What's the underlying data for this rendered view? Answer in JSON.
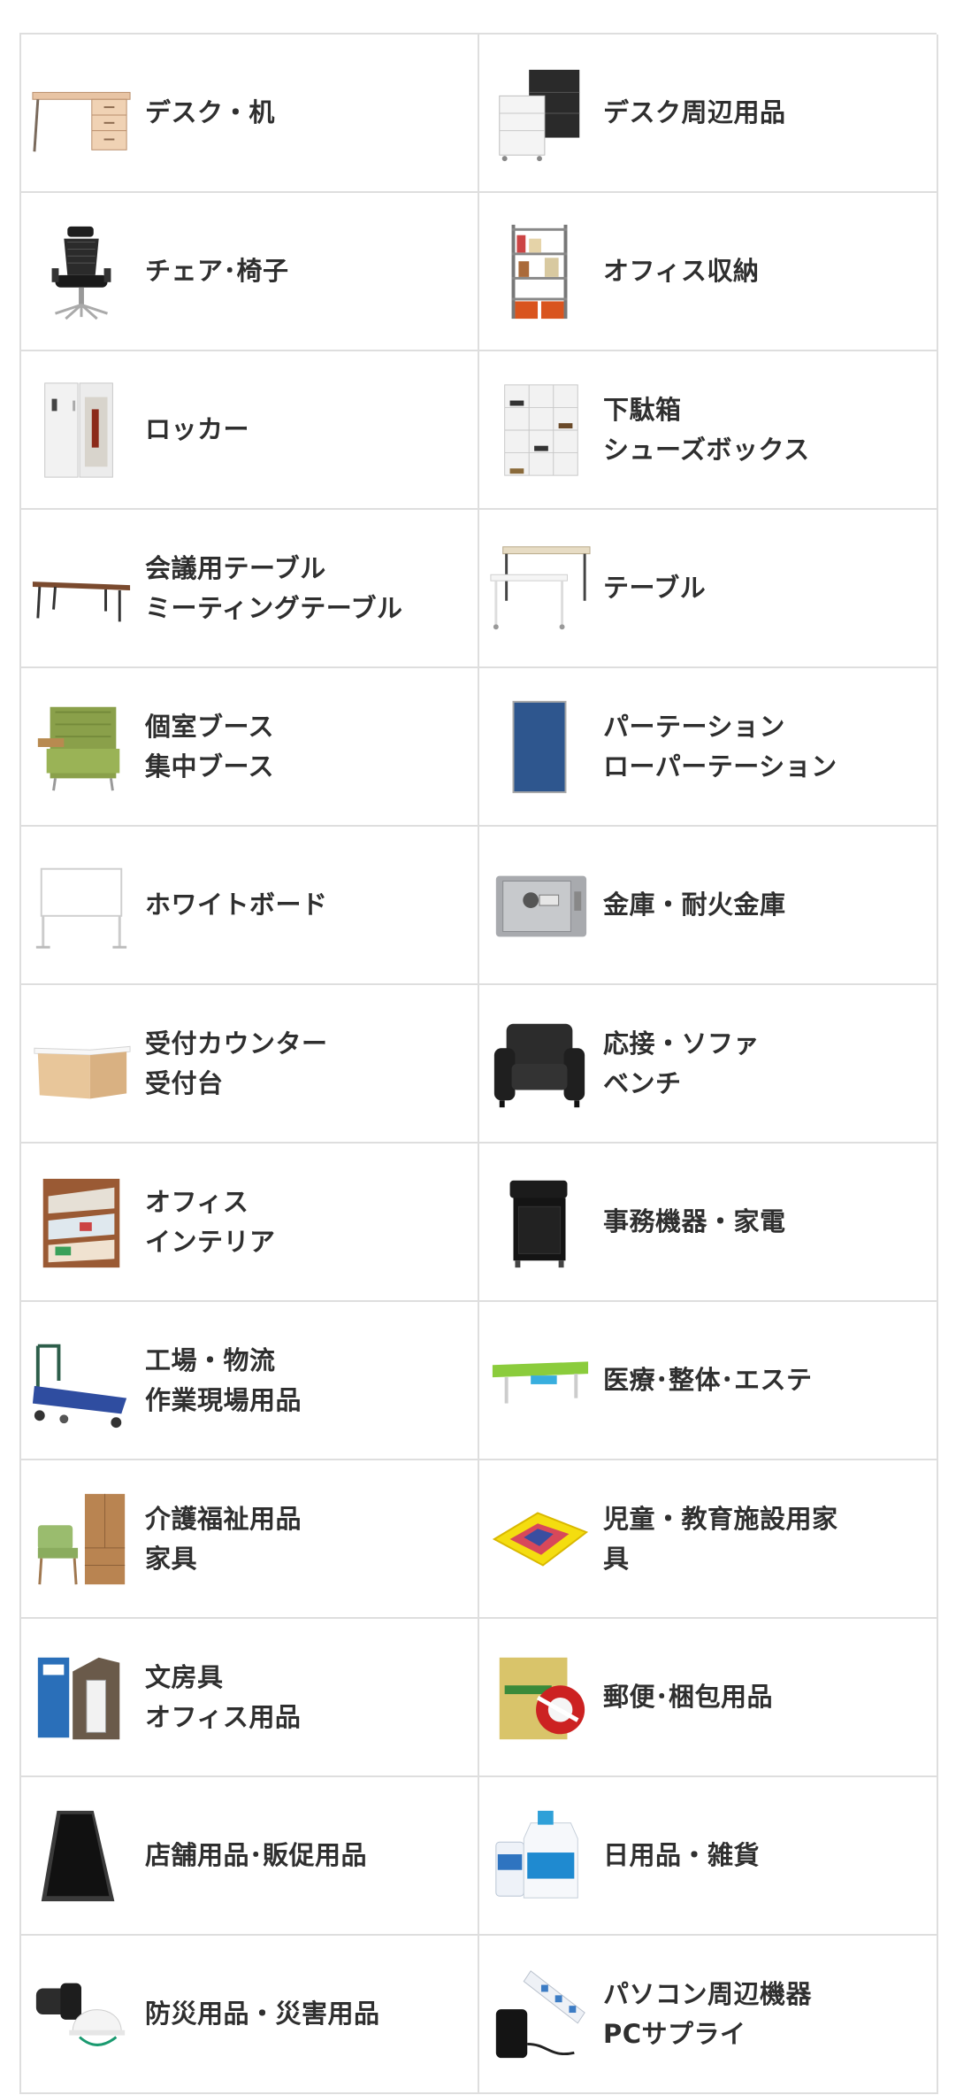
{
  "categories": [
    {
      "label": "デスク・机",
      "icon": "desk-icon"
    },
    {
      "label": "デスク周辺用品",
      "icon": "desk-pedestal-icon"
    },
    {
      "label": "チェア･椅子",
      "icon": "office-chair-icon"
    },
    {
      "label": "オフィス収納",
      "icon": "storage-shelf-icon"
    },
    {
      "label": "ロッカー",
      "icon": "locker-icon"
    },
    {
      "label": "下駄箱\nシューズボックス",
      "icon": "shoe-box-icon"
    },
    {
      "label": "会議用テーブル\nミーティングテーブル",
      "icon": "folding-table-icon"
    },
    {
      "label": "テーブル",
      "icon": "table-icon"
    },
    {
      "label": "個室ブース\n集中ブース",
      "icon": "booth-chair-icon"
    },
    {
      "label": "パーテーション\nローパーテーション",
      "icon": "partition-icon"
    },
    {
      "label": "ホワイトボード",
      "icon": "whiteboard-icon"
    },
    {
      "label": "金庫・耐火金庫",
      "icon": "safe-icon"
    },
    {
      "label": "受付カウンター\n受付台",
      "icon": "reception-counter-icon"
    },
    {
      "label": "応接・ソファ\nベンチ",
      "icon": "sofa-icon"
    },
    {
      "label": "オフィス\nインテリア",
      "icon": "magazine-rack-icon"
    },
    {
      "label": "事務機器・家電",
      "icon": "shredder-icon"
    },
    {
      "label": "工場・物流\n作業現場用品",
      "icon": "hand-truck-icon"
    },
    {
      "label": "医療･整体･エステ",
      "icon": "treatment-bed-icon"
    },
    {
      "label": "介護福祉用品\n家具",
      "icon": "care-furniture-icon"
    },
    {
      "label": "児童・教育施設用家\n具",
      "icon": "play-mat-icon"
    },
    {
      "label": "文房具\nオフィス用品",
      "icon": "file-box-icon"
    },
    {
      "label": "郵便･梱包用品",
      "icon": "packing-tape-icon"
    },
    {
      "label": "店舗用品･販促用品",
      "icon": "a-frame-sign-icon"
    },
    {
      "label": "日用品・雑貨",
      "icon": "detergent-bottle-icon"
    },
    {
      "label": "防災用品・災害用品",
      "icon": "flashlight-helmet-icon"
    },
    {
      "label": "パソコン周辺機器\nPCサプライ",
      "icon": "power-strip-icon"
    }
  ]
}
